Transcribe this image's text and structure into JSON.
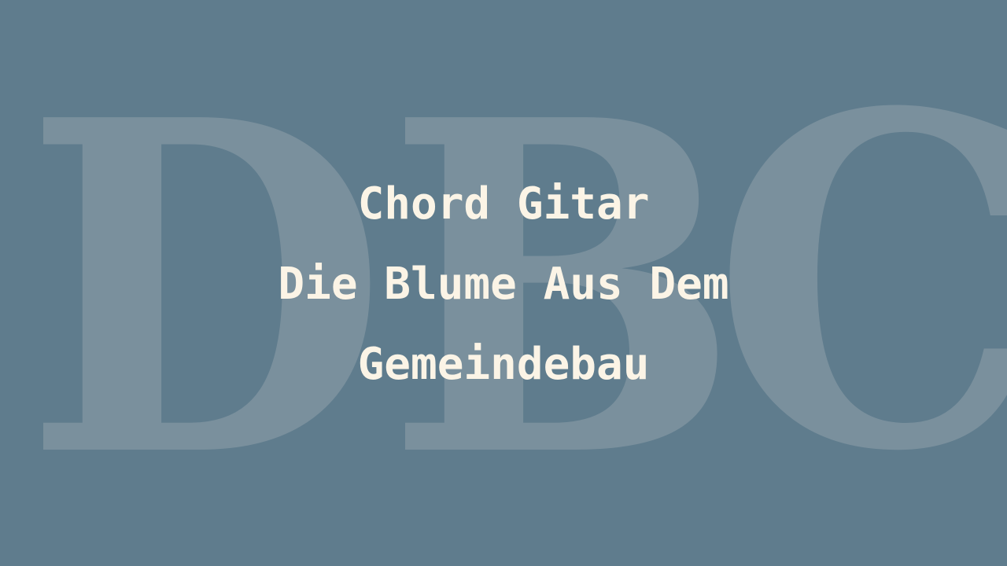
{
  "watermark": {
    "letters": [
      "D",
      "B",
      "C"
    ]
  },
  "title": {
    "line1": "Chord Gitar",
    "line2": "Die Blume Aus Dem",
    "line3": "Gemeindebau"
  },
  "colors": {
    "background": "#5f7c8d",
    "watermark": "#7a909d",
    "text": "#fbf4e6"
  }
}
